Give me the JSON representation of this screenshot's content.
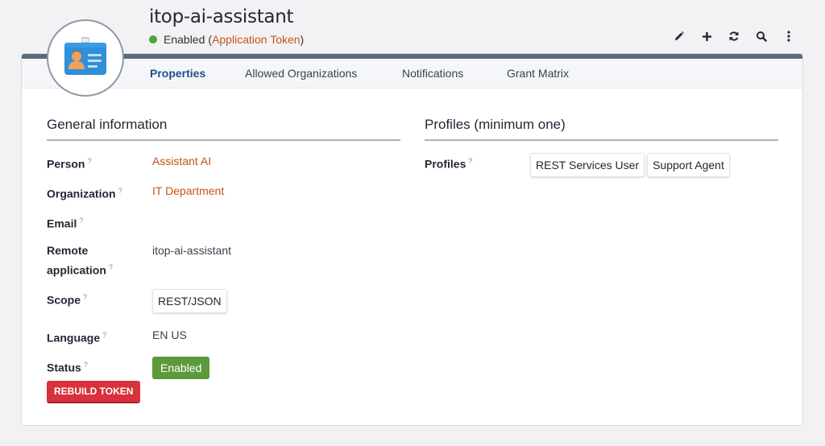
{
  "header": {
    "title": "itop-ai-assistant",
    "status_label": "Enabled",
    "status_link": "Application Token",
    "status_color": "#4ea33b"
  },
  "toolbar": {
    "icons": [
      "pencil-icon",
      "plus-icon",
      "refresh-icon",
      "search-icon",
      "more-vertical-icon"
    ]
  },
  "tabs": [
    {
      "label": "Properties",
      "active": true
    },
    {
      "label": "Allowed Organizations",
      "active": false
    },
    {
      "label": "Notifications",
      "active": false
    },
    {
      "label": "Grant Matrix",
      "active": false
    }
  ],
  "general": {
    "title": "General information",
    "person_label": "Person",
    "person_value": "Assistant AI",
    "organization_label": "Organization",
    "organization_value": "IT Department",
    "email_label": "Email",
    "remote_label_1": "Remote",
    "remote_label_2": "application",
    "remote_value": "itop-ai-assistant",
    "scope_label": "Scope",
    "scope_value": "REST/JSON",
    "language_label": "Language",
    "language_value": "EN US",
    "status_label": "Status",
    "status_value": "Enabled",
    "rebuild_label": "REBUILD TOKEN",
    "help_mark": "?"
  },
  "profiles": {
    "title": "Profiles (minimum one)",
    "label": "Profiles",
    "items": [
      "REST Services User",
      "Support Agent"
    ]
  },
  "colors": {
    "accent": "#1f4f8b",
    "link": "#c65416",
    "enabled": "#5b9a3a",
    "danger": "#d8323c"
  }
}
